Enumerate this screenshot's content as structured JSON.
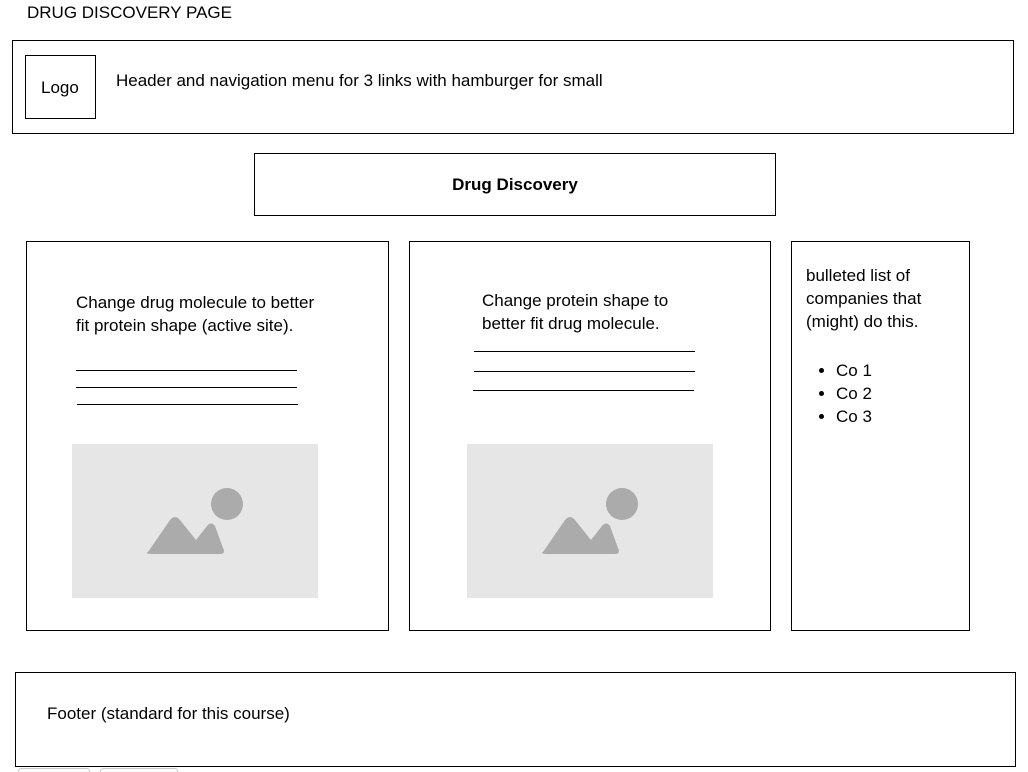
{
  "page_title": "DRUG DISCOVERY PAGE",
  "header": {
    "logo_label": "Logo",
    "description": "Header and navigation menu for 3 links with hamburger for small"
  },
  "banner": {
    "title": "Drug Discovery"
  },
  "columns": [
    {
      "text": "Change drug molecule to better fit protein shape (active site).",
      "image_icon": "image-placeholder-icon"
    },
    {
      "text": "Change protein shape to better fit drug molecule.",
      "image_icon": "image-placeholder-icon"
    }
  ],
  "sidebar": {
    "text": "bulleted list of companies that (might) do this.",
    "items": [
      "Co 1",
      "Co 2",
      "Co 3"
    ]
  },
  "footer": {
    "text": "Footer (standard for this course)"
  },
  "colors": {
    "border": "#000000",
    "image_bg": "#e6e6e6",
    "image_icon": "#ababab"
  }
}
